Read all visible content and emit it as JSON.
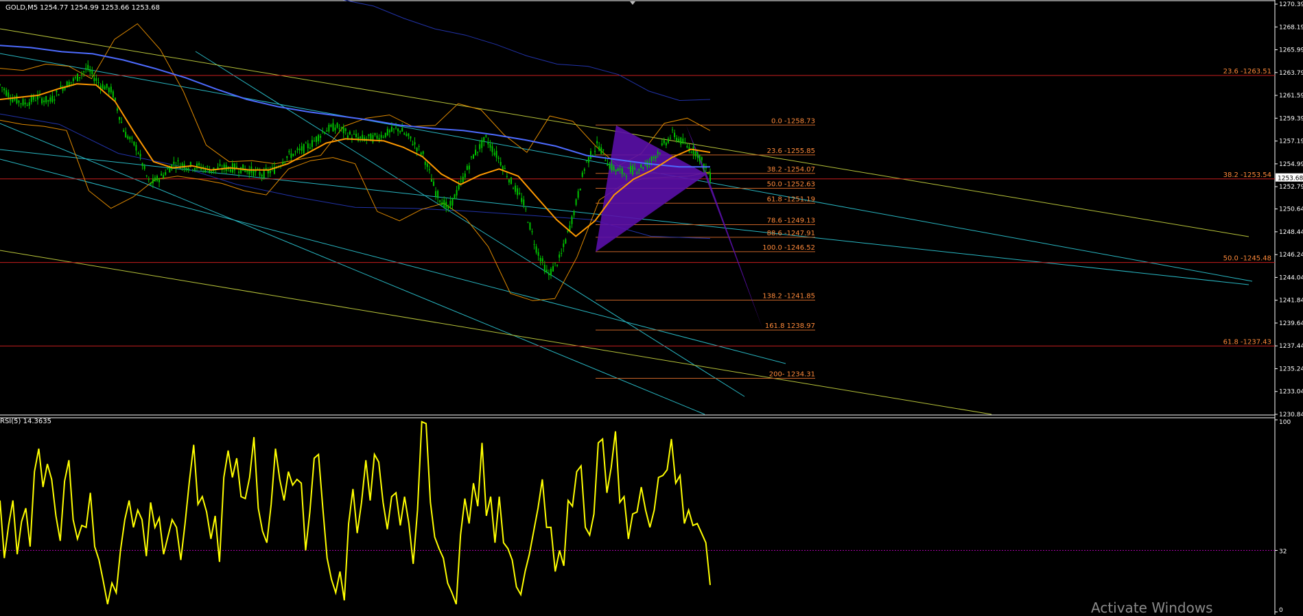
{
  "header": {
    "symbol_label": "GOLD,M5",
    "ohlc": "1254.77 1254.99 1253.66 1253.68"
  },
  "rsi_label": "RSI(5) 14.3635",
  "watermark": "Activate Windows",
  "colors": {
    "background": "#000000",
    "candles": "#00c400",
    "ma_orange": "#ff9900",
    "ma_blue": "#4d6bff",
    "band_orange": "#e08a00",
    "band_blue": "#2233aa",
    "channel_cyan": "#29b8c4",
    "trend_yellow": "#b8c43a",
    "fib_line": "#c86428",
    "fib_text": "#ff8a3a",
    "hline_red": "#c81e1e",
    "pattern": "#5a10a8",
    "rsi": "#ffff00",
    "rsi_level": "#b000b0",
    "axis_text": "#ffffff"
  },
  "chart_data": [
    {
      "type": "candlestick",
      "title": "",
      "ylim": [
        1230.84,
        1270.39
      ],
      "y_ticks": [
        "1270.39",
        "1268.19",
        "1265.99",
        "1263.79",
        "1261.59",
        "1259.39",
        "1257.19",
        "1254.99",
        "1252.79",
        "1250.64",
        "1248.44",
        "1246.24",
        "1244.04",
        "1241.84",
        "1239.64",
        "1237.44",
        "1235.24",
        "1233.04",
        "1230.84"
      ],
      "current_price": "1253.68",
      "price_path": [
        1262.6,
        1261.3,
        1260.8,
        1261.4,
        1261.0,
        1262.4,
        1263.1,
        1264.2,
        1262.7,
        1262.0,
        1258.0,
        1256.5,
        1253.0,
        1253.8,
        1255.1,
        1254.8,
        1254.7,
        1254.4,
        1254.6,
        1254.6,
        1254.4,
        1254.0,
        1254.4,
        1255.7,
        1256.2,
        1256.9,
        1258.2,
        1258.6,
        1257.8,
        1257.4,
        1257.5,
        1257.9,
        1258.4,
        1257.3,
        1255.8,
        1252.2,
        1250.6,
        1253.1,
        1255.8,
        1257.4,
        1255.6,
        1253.3,
        1251.3,
        1247.0,
        1244.2,
        1246.0,
        1250.0,
        1255.0,
        1256.9,
        1254.7,
        1254.1,
        1254.5,
        1255.0,
        1256.4,
        1257.9,
        1256.8,
        1256.0,
        1253.7
      ],
      "ma_orange_path": [
        1261.2,
        1261.4,
        1261.6,
        1262.2,
        1262.7,
        1262.6,
        1261.0,
        1258.0,
        1255.2,
        1254.6,
        1254.8,
        1254.4,
        1254.6,
        1254.4,
        1254.4,
        1255.0,
        1256.0,
        1257.0,
        1257.4,
        1257.3,
        1257.2,
        1256.6,
        1255.7,
        1254.0,
        1253.0,
        1253.9,
        1254.5,
        1253.8,
        1251.7,
        1249.6,
        1248.0,
        1249.5,
        1252.0,
        1253.5,
        1254.4,
        1255.6,
        1256.4,
        1256.1
      ],
      "ma_blue_path": [
        1266.4,
        1266.2,
        1265.8,
        1265.6,
        1265.0,
        1264.2,
        1263.3,
        1262.2,
        1261.2,
        1260.5,
        1260.0,
        1259.6,
        1259.2,
        1258.7,
        1258.4,
        1258.2,
        1257.8,
        1257.3,
        1256.7,
        1255.8,
        1255.4,
        1255.0,
        1254.7,
        1254.7
      ],
      "band_orange_upper": [
        1264.2,
        1264.0,
        1264.6,
        1264.4,
        1263.2,
        1267.0,
        1268.5,
        1266.0,
        1262.0,
        1256.8,
        1255.2,
        1255.3,
        1255.0,
        1255.4,
        1255.8,
        1258.6,
        1259.4,
        1259.7,
        1258.6,
        1258.7,
        1260.8,
        1260.2,
        1257.8,
        1256.1,
        1259.6,
        1259.1,
        1256.7,
        1254.8,
        1256.0,
        1258.9,
        1259.4,
        1258.2
      ],
      "band_orange_lower": [
        1259.2,
        1258.8,
        1258.6,
        1258.2,
        1252.4,
        1250.7,
        1251.8,
        1253.5,
        1253.8,
        1253.5,
        1253.1,
        1252.4,
        1252.0,
        1254.5,
        1255.3,
        1255.6,
        1255.0,
        1250.4,
        1249.5,
        1250.6,
        1251.2,
        1249.7,
        1247.0,
        1242.5,
        1241.8,
        1242.0,
        1246.0,
        1251.5,
        1252.9,
        1253.6,
        1253.7,
        1253.8,
        1254.2
      ],
      "band_blue_upper": [
        1270.8,
        1270.2,
        1269.0,
        1268.0,
        1267.4,
        1266.5,
        1265.4,
        1264.6,
        1264.4,
        1263.6,
        1262.0,
        1261.1,
        1261.2
      ],
      "band_blue_lower": [
        1259.8,
        1258.8,
        1256.0,
        1254.8,
        1253.0,
        1251.8,
        1250.8,
        1250.7,
        1250.4,
        1250.0,
        1249.6,
        1248.0,
        1247.8
      ],
      "fibonacci_levels": [
        {
          "label": "0.0 -1258.73",
          "price": 1258.73
        },
        {
          "label": "23.6 -1255.85",
          "price": 1255.85
        },
        {
          "label": "38.2 -1254.07",
          "price": 1254.07
        },
        {
          "label": "50.0 -1252.63",
          "price": 1252.63
        },
        {
          "label": "61.8 -1251.19",
          "price": 1251.19
        },
        {
          "label": "78.6 -1249.13",
          "price": 1249.13
        },
        {
          "label": "88.6 -1247.91",
          "price": 1247.91
        },
        {
          "label": "100.0 -1246.52",
          "price": 1246.52
        },
        {
          "label": "138.2 -1241.85",
          "price": 1241.85
        },
        {
          "label": "161.8 1238.97",
          "price": 1238.97
        },
        {
          "label": "200- 1234.31",
          "price": 1234.31
        }
      ],
      "horizontal_levels": [
        {
          "label": "23.6 -1263.51",
          "price": 1263.51
        },
        {
          "label": "38.2 -1253.54",
          "price": 1253.54
        },
        {
          "label": "50.0 -1245.48",
          "price": 1245.48
        },
        {
          "label": "61.8 -1237.43",
          "price": 1237.43
        }
      ],
      "harmonic_pattern": {
        "triangle_1": [
          1246.5,
          1258.7,
          1254.0
        ],
        "triangle_2": [
          1254.0,
          1258.7,
          1239.0
        ]
      }
    },
    {
      "type": "line",
      "title": "RSI(5) 14.3635",
      "ylim": [
        0,
        100
      ],
      "y_ticks": [
        "100",
        "32",
        "0"
      ],
      "level": 32,
      "values": [
        58,
        28,
        45,
        58,
        30,
        47,
        54,
        34,
        73,
        85,
        65,
        77,
        69,
        50,
        37,
        68,
        79,
        48,
        38,
        45,
        44,
        62,
        34,
        27,
        16,
        4,
        15,
        10,
        32,
        48,
        58,
        44,
        53,
        48,
        29,
        57,
        44,
        49,
        30,
        39,
        48,
        44,
        27,
        46,
        68,
        87,
        56,
        60,
        52,
        38,
        50,
        26,
        70,
        84,
        70,
        80,
        60,
        59,
        70,
        91,
        54,
        42,
        36,
        56,
        85,
        69,
        58,
        73,
        66,
        69,
        67,
        32,
        52,
        80,
        82,
        54,
        28,
        17,
        10,
        21,
        6,
        46,
        64,
        41,
        57,
        79,
        58,
        82,
        78,
        57,
        43,
        60,
        62,
        45,
        60,
        46,
        25,
        53,
        99,
        98,
        57,
        39,
        33,
        28,
        15,
        10,
        4,
        40,
        59,
        46,
        67,
        55,
        88,
        50,
        60,
        36,
        60,
        36,
        33,
        27,
        13,
        9,
        21,
        30,
        42,
        54,
        69,
        44,
        44,
        21,
        32,
        24,
        58,
        55,
        73,
        76,
        44,
        40,
        51,
        88,
        90,
        62,
        75,
        94,
        57,
        60,
        38,
        51,
        52,
        65,
        53,
        44,
        53,
        70,
        71,
        74,
        90,
        67,
        71,
        46,
        53,
        45,
        46,
        41,
        36,
        14
      ]
    }
  ]
}
